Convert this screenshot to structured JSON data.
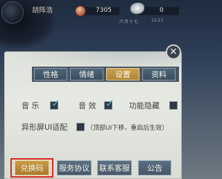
{
  "hud": {
    "player_name": "胡阵浩",
    "coins": "7305",
    "jade": "0",
    "date": "六月十七",
    "clock": "12:13"
  },
  "tabs": [
    {
      "label": "性格",
      "active": false
    },
    {
      "label": "情绪",
      "active": false
    },
    {
      "label": "设置",
      "active": true
    },
    {
      "label": "资料",
      "active": false
    }
  ],
  "settings": {
    "music_label": "音 乐",
    "music_on": true,
    "sfx_label": "音 效",
    "sfx_on": true,
    "hide_features_label": "功能隐藏",
    "hide_features_on": false,
    "notch_label": "异形屏UI适配",
    "notch_on": false,
    "notch_hint": "（顶部UI下移，重启后生效）"
  },
  "buttons": {
    "redeem": "兑换码",
    "terms": "服务协议",
    "support": "联系客服",
    "notice": "公告"
  },
  "icons": {
    "close": "close-icon",
    "check": "check-icon",
    "coin": "coin-icon",
    "jade": "jade-icon"
  }
}
